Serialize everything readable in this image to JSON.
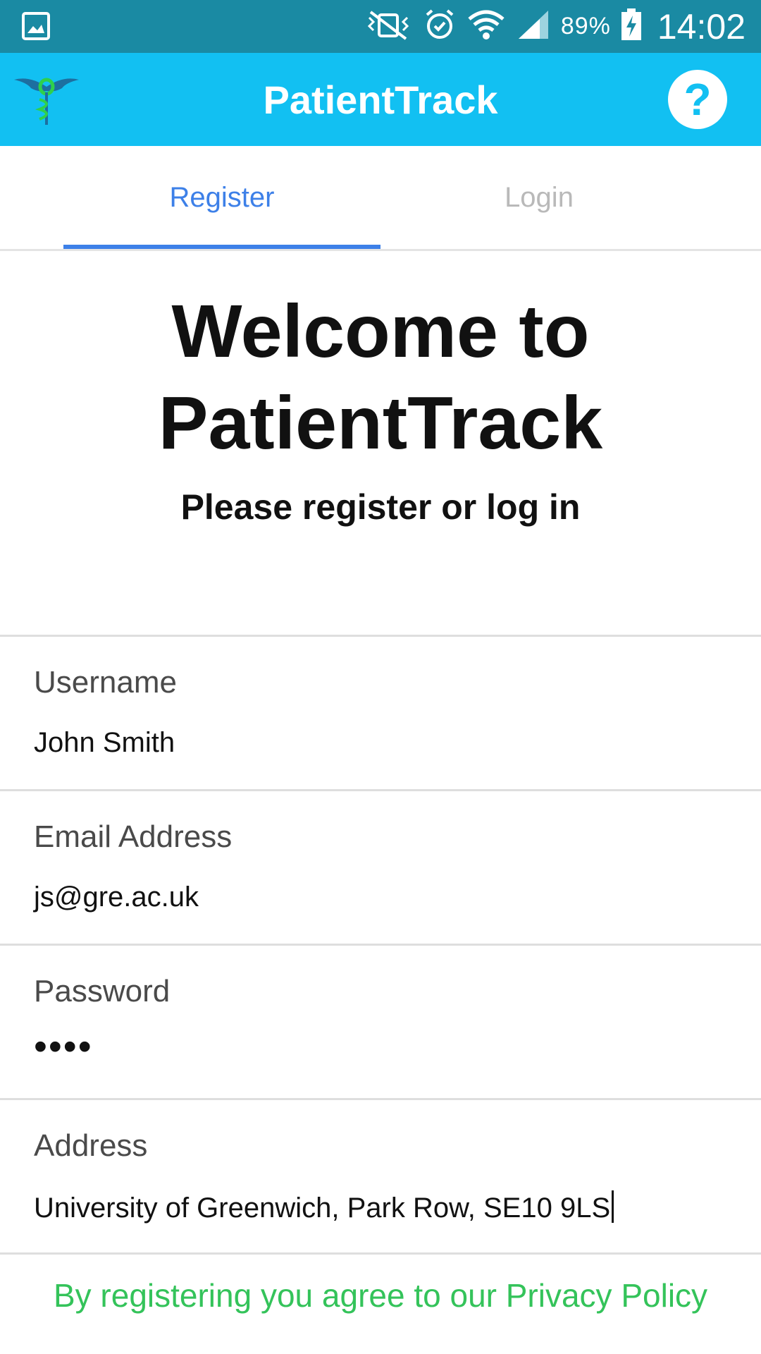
{
  "status_bar": {
    "battery": "89%",
    "time": "14:02",
    "icons": [
      "gallery-icon",
      "vibrate-off-icon",
      "alarm-icon",
      "wifi-icon",
      "signal-icon",
      "battery-charging-icon"
    ]
  },
  "app_bar": {
    "title": "PatientTrack",
    "help_label": "?"
  },
  "tabs": [
    {
      "label": "Register",
      "active": true
    },
    {
      "label": "Login",
      "active": false
    }
  ],
  "welcome": {
    "title_line1": "Welcome to",
    "title_line2": "PatientTrack",
    "subtitle": "Please register or log in"
  },
  "form": {
    "username": {
      "label": "Username",
      "value": "John Smith"
    },
    "email": {
      "label": "Email Address",
      "value": "js@gre.ac.uk"
    },
    "password": {
      "label": "Password",
      "value": "••••"
    },
    "address": {
      "label": "Address",
      "value": "University of Greenwich, Park Row, SE10 9LS"
    }
  },
  "privacy_text": "By registering you agree to our Privacy Policy",
  "colors": {
    "status_bar": "#1a8aa3",
    "app_bar": "#12c0f2",
    "accent_tab": "#3d80e8",
    "privacy_link": "#34c35a"
  }
}
